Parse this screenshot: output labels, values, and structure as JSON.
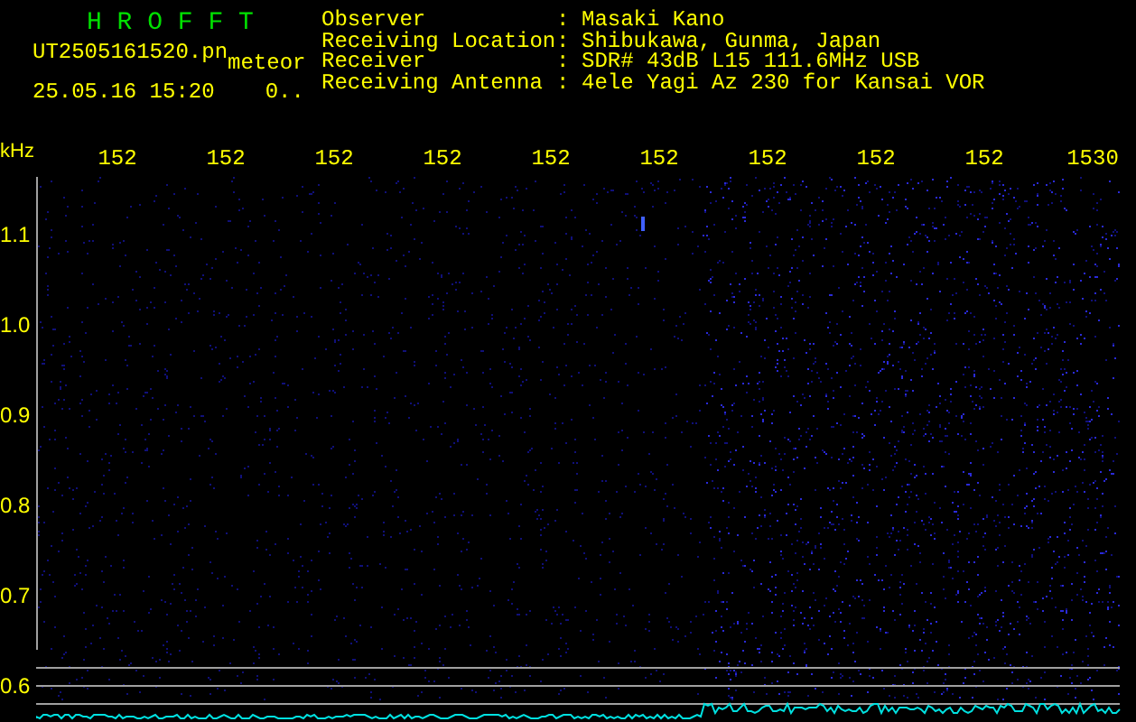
{
  "header": {
    "title": "H R O F F T",
    "file_name": "UT2505161520.pn",
    "mode": "meteor",
    "timestamp": "25.05.16 15:20",
    "count": "0..",
    "info": [
      {
        "label": "Observer",
        "separator": ":",
        "value": "Masaki Kano"
      },
      {
        "label": "Receiving Location",
        "separator": ":",
        "value": "Shibukawa, Gunma, Japan"
      },
      {
        "label": "Receiver",
        "separator": ":",
        "value": "SDR# 43dB L15 111.6MHz USB"
      },
      {
        "label": "Receiving Antenna",
        "separator": ":",
        "value": "4ele Yagi Az 230 for Kansai VOR"
      }
    ]
  },
  "spectrogram": {
    "unit": "kHz",
    "x_labels": [
      "152",
      "152",
      "152",
      "152",
      "152",
      "152",
      "152",
      "152",
      "152",
      "1530"
    ],
    "y_labels": [
      "1.1",
      "1.0",
      "0.9",
      "0.8",
      "0.7",
      "0.6"
    ]
  }
}
